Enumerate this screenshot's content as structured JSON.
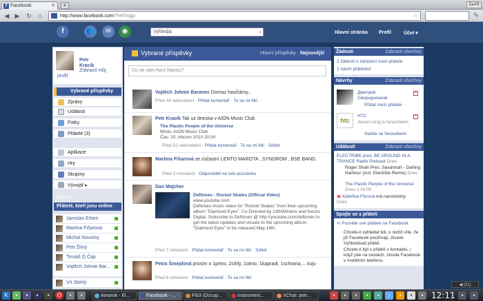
{
  "browser": {
    "tab_title": "Facebook",
    "url_host": "http://www.facebook.com",
    "url_rest": "/?ref=logo",
    "window_button": "Zavřít"
  },
  "fbbar": {
    "search_placeholder": "Vyhledat",
    "links": [
      "Hlavní stránka",
      "Profil",
      "Účet ▾"
    ]
  },
  "profile": {
    "first": "Petr",
    "last": "Kracík",
    "edit_photo": "Zobrazit můj",
    "profile_link": "profil"
  },
  "nav": {
    "selected": "Vybrané příspěvky",
    "items": [
      "Zprávy",
      "Události",
      "Fotky",
      "Přátelé (3)"
    ],
    "apps": [
      "Aplikace",
      "Hry",
      "Skupiny",
      "Vývojář ▸"
    ],
    "more": "Další ▾"
  },
  "friends": {
    "title": "Přátelé, kteří jsou online",
    "list": [
      "Jaroslav Erben",
      "Martina Fišarová",
      "Michal Novotný",
      "Petr Žitný",
      "Tomáš Ó Čáp",
      "Vojtěch Johnie Bar...",
      "Vít Steklý"
    ]
  },
  "feed": {
    "title": "Vybrané příspěvky",
    "tab_main": "Hlavní příspěvky",
    "sep": "·",
    "tab_new": "Nejnovější",
    "status_placeholder": "Co se vám honí hlavou?",
    "posts": [
      {
        "author": "Vojtěch Johnie Baranec",
        "text": " Domaz hasičárny..",
        "meta_time": "Před 34 sekundami",
        "meta_comment": "Přidat komentář",
        "meta_like": "To se mi líbí"
      },
      {
        "author": "Petr Kracík",
        "text": " Tak uz dneska v AION Music Club",
        "sub_title": "The Plastic People of the Universe",
        "sub_place": "Místo: AION Music Club",
        "sub_time": "Čas: 20. březen 2010 20:00",
        "meta_time": "Před 52 sekundami",
        "meta_comment": "Přidat komentář",
        "meta_like": "To se mi líbí",
        "meta_share": "Sdílet"
      },
      {
        "author": "Martina Fišarová",
        "text": " se zúčastní LENTO MAROTA , SYNDROM , BSE BAND.",
        "meta_time": "Před 3 minutami",
        "meta_rsvp": "Odpovědět na tuto pozvánku"
      },
      {
        "author": "Dan Majcher",
        "link_title": "Deftones - Rocket Skates (Official Video)",
        "link_host": "www.youtube.com",
        "link_desc": "Deftones music video for \"Rocket Skates\" from their upcoming album \"Diamond Eyes\". Co-Directed by 13thWitness and Kenzo Digital. Subscribe to Deftones @ http://youtube.com/deftones to get the latest updates and visuals to the upcoming album \"Diamond Eyes\" to be released May 18th.",
        "meta_time": "Před 7 minutami",
        "meta_comment": "Přidat komentář",
        "meta_like": "To se mi líbí",
        "meta_share": "Sdílet"
      },
      {
        "author": "Petra Šmejdová",
        "text": " prosim o 1prino, 2cihly, 1okno, 1kapradi, 1schrana,... kuju",
        "meta_time": "Před 8 minutami",
        "meta_comment": "Přidat komentář",
        "meta_like": "To se mi líbí"
      }
    ]
  },
  "right": {
    "requests": {
      "title": "Žádosti",
      "all": "Zobrazit všechny",
      "l1": "2 žádosti o zařazení mezi přátele",
      "l2": "1 návrh přátelství"
    },
    "suggest": {
      "title": "Návrhy",
      "all": "Zobrazit všechny",
      "p1_name": "Дмитрий Свиридченков",
      "p1_action": "Přidat mezi přátele",
      "p2_name": "HTC",
      "p2_sub": "Jesse Long je fanouškem.",
      "p2_action": "Staňte se fanouškem"
    },
    "events": {
      "title": "Události",
      "all": "Zobrazit všechny",
      "e1": "ELECTRIBE pres. BE AROUND IN A TRANCE Radio Podcast",
      "e1_when": "Dnes",
      "e2": "Roger Shah Pres. Savannah - Darling Harbour (incl. Electribe Remix)",
      "e2_when": "Dnes",
      "e3": "The Plastic People of the Universe",
      "e3_when": "Dnes v 20:00",
      "e4": "Kateřina Fikrová",
      "e4_rest": " má narozeniny.",
      "e4_when": "Dnes"
    },
    "connect": {
      "title": "Spojte se s přáteli",
      "l1": "Pozvěte své přátele na Facebook",
      "l2": "Chcete-li vyhledat lidi, o nichž víte, že již Facebook používají, zkuste Vyhledávač přátel.",
      "l3": "Chcete-li být s přáteli v kontaktu, i když jste na cestách, zkuste Facebook v mobilním telefonu."
    }
  },
  "taskbar": {
    "items": [
      "Amarok - El...",
      "Facebook - ...",
      "Fib3 (Occup...",
      "Instrument...",
      "XChat: petr..."
    ],
    "clock": "12:11",
    "tray": "◀ (21)"
  },
  "colors": {
    "fb_blue": "#3b5998",
    "bg": "#1b3a61"
  }
}
